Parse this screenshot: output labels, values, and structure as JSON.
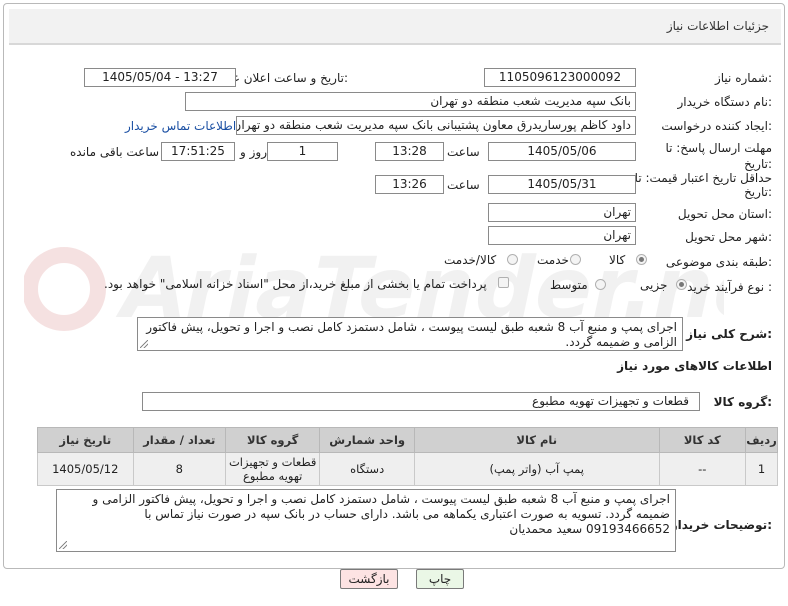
{
  "panel": {
    "title": "جزئیات اطلاعات نیاز"
  },
  "fields": {
    "need_number_label": "شماره نیاز:",
    "need_number": "1105096123000092",
    "announce_label": "تاریخ و ساعت اعلان عمومی:",
    "announce_value": "1405/05/04 - 13:27",
    "buyer_org_label": "نام دستگاه خریدار:",
    "buyer_org": "بانک سپه مدیریت شعب منطقه دو تهران",
    "creator_label": "ایجاد کننده درخواست:",
    "creator": "داود کاظم پورساریدرق معاون پشتیبانی بانک سپه مدیریت شعب منطقه دو تهران",
    "contact_link": "اطلاعات تماس خریدار",
    "deadline_label": "مهلت ارسال پاسخ: تا تاریخ:",
    "deadline_date": "1405/05/06",
    "time_label": "ساعت",
    "deadline_time": "13:28",
    "days": "1",
    "days_label": "روز و",
    "remaining": "17:51:25",
    "remaining_label": "ساعت باقی مانده",
    "price_label": "حداقل تاریخ اعتبار قیمت: تا تاریخ:",
    "price_date": "1405/05/31",
    "price_time_label": "ساعت",
    "price_time": "13:26",
    "province_label": "استان محل تحویل:",
    "province": "تهران",
    "city_label": "شهر محل تحویل:",
    "city": "تهران",
    "category_label": "طبقه بندی موضوعی:",
    "category_options": [
      "کالا",
      "خدمت",
      "کالا/خدمت"
    ],
    "process_label": "نوع فرآیند خرید :",
    "process_options": [
      "جزیی",
      "متوسط"
    ],
    "payment_note": "پرداخت تمام یا بخشی از مبلغ خرید،از محل \"اسناد خزانه اسلامی\" خواهد بود."
  },
  "description": {
    "label": "شرح کلی نیاز:",
    "text": "اجرای پمپ و منبع آب 8 شعبه طبق لیست پیوست ، شامل دستمزد کامل نصب و اجرا و تحویل، پیش فاکتور الزامی و ضمیمه گردد."
  },
  "goods": {
    "section_title": "اطلاعات کالاهای مورد نیاز",
    "group_label": "گروه کالا:",
    "group_value": "قطعات و تجهیزات تهویه مطبوع",
    "columns": [
      "ردیف",
      "کد کالا",
      "نام کالا",
      "واحد شمارش",
      "گروه کالا",
      "تعداد / مقدار",
      "تاریخ نیاز"
    ],
    "rows": [
      [
        "1",
        "--",
        "پمپ آب (واتر پمپ)",
        "دستگاه",
        "قطعات و تجهیزات تهویه مطبوع",
        "8",
        "1405/05/12"
      ]
    ]
  },
  "buyer_notes": {
    "label": "توضیحات خریدار:",
    "text": "اجرای پمپ و منبع آب 8 شعبه طبق لیست پیوست ، شامل دستمزد کامل نصب و اجرا و تحویل، پیش فاکتور الزامی و ضمیمه گردد. تسویه به صورت اعتباری یکماهه می باشد. دارای حساب در بانک سپه در صورت نیاز تماس با 09193466652 سعید محمدیان"
  },
  "buttons": {
    "print": "چاپ",
    "back": "بازگشت"
  },
  "watermark": {
    "text": "AriaTender.net"
  },
  "colors": {
    "link": "#1a4fa3",
    "back_button_bg": "#fde3e3",
    "print_button_bg": "#eaf7e6",
    "header_bg": "#d0d0d0"
  }
}
